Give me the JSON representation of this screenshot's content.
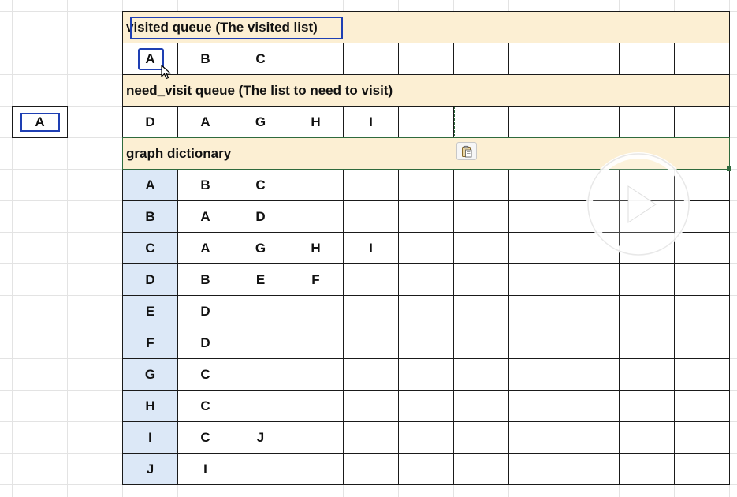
{
  "side_cell": {
    "value": "A"
  },
  "sheet": {
    "visited_header": "visited queue (The visited list)",
    "visited_values": [
      "A",
      "B",
      "C",
      "",
      "",
      "",
      "",
      "",
      "",
      "",
      ""
    ],
    "need_visit_header": "need_visit queue (The list to need to visit)",
    "need_visit_values": [
      "D",
      "A",
      "G",
      "H",
      "I",
      "",
      "",
      "",
      "",
      "",
      ""
    ],
    "graph_header": "graph dictionary",
    "graph_rows": [
      [
        "A",
        "B",
        "C",
        "",
        "",
        "",
        "",
        "",
        "",
        "",
        ""
      ],
      [
        "B",
        "A",
        "D",
        "",
        "",
        "",
        "",
        "",
        "",
        "",
        ""
      ],
      [
        "C",
        "A",
        "G",
        "H",
        "I",
        "",
        "",
        "",
        "",
        "",
        ""
      ],
      [
        "D",
        "B",
        "E",
        "F",
        "",
        "",
        "",
        "",
        "",
        "",
        ""
      ],
      [
        "E",
        "D",
        "",
        "",
        "",
        "",
        "",
        "",
        "",
        "",
        ""
      ],
      [
        "F",
        "D",
        "",
        "",
        "",
        "",
        "",
        "",
        "",
        "",
        ""
      ],
      [
        "G",
        "C",
        "",
        "",
        "",
        "",
        "",
        "",
        "",
        "",
        ""
      ],
      [
        "H",
        "C",
        "",
        "",
        "",
        "",
        "",
        "",
        "",
        "",
        ""
      ],
      [
        "I",
        "C",
        "J",
        "",
        "",
        "",
        "",
        "",
        "",
        "",
        ""
      ],
      [
        "J",
        "I",
        "",
        "",
        "",
        "",
        "",
        "",
        "",
        "",
        ""
      ]
    ]
  },
  "colors": {
    "header_fill": "#fcefd3",
    "key_fill": "#dce8f7",
    "highlight_box": "#1e3fb3",
    "selection_green": "#2f6a3d"
  },
  "icons": {
    "cursor": "mouse-pointer-icon",
    "paste": "paste-options-icon",
    "play": "play-icon"
  }
}
